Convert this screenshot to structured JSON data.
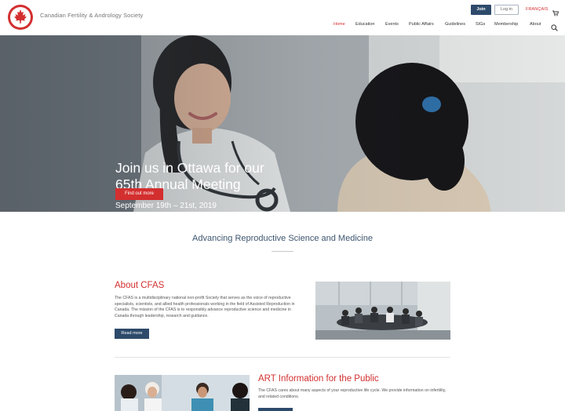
{
  "header": {
    "site_name": "Canadian Fertility & Andrology Society",
    "join_label": "Join",
    "login_label": "Log in",
    "language_label": "FRANÇAIS",
    "brand_color": "#d32f2f",
    "navy_color": "#2d4a6b"
  },
  "nav": {
    "items": [
      {
        "label": "Home",
        "active": true
      },
      {
        "label": "Education"
      },
      {
        "label": "Events"
      },
      {
        "label": "Public Affairs"
      },
      {
        "label": "Guidelines"
      },
      {
        "label": "SIGs"
      },
      {
        "label": "Membership"
      },
      {
        "label": "About"
      }
    ]
  },
  "hero": {
    "title_line1": "Join us in Ottawa for our",
    "title_line2": "65th Annual Meeting",
    "date": "September 19th – 21st, 2019",
    "cta_label": "Find out more"
  },
  "tagline": "Advancing Reproductive Science and Medicine",
  "about": {
    "title": "About CFAS",
    "text": "The CFAS is a multidisciplinary national non-profit Society that serves as the voice of reproductive specialists, scientists, and allied health professionals working in the field of Assisted Reproduction in Canada. The mission of the CFAS is to responsibly advance reproductive science and medicine in Canada through leadership, research and guidance.",
    "button_label": "Read more"
  },
  "art": {
    "title": "ART Information for the Public",
    "text": "The CFAS cares about many aspects of your reproductive life cycle. We provide information on infertility, and related conditions."
  },
  "icons": {
    "logo": "maple-leaf-icon",
    "cart": "cart-icon",
    "search": "search-icon"
  }
}
